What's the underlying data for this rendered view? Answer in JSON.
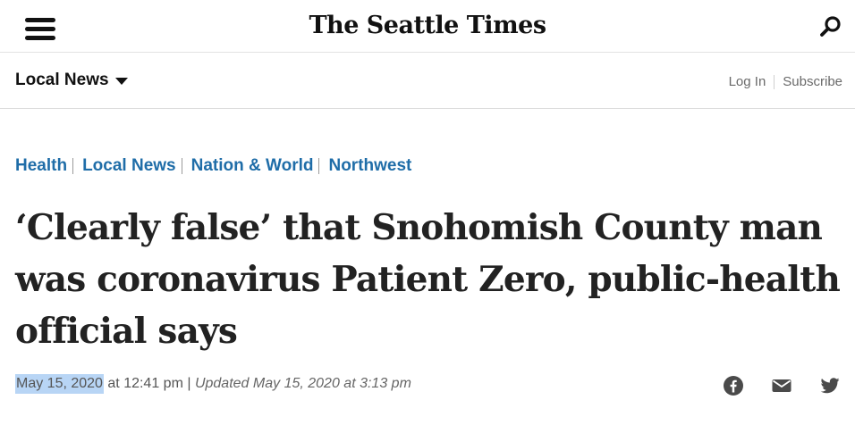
{
  "header": {
    "logo_text": "The Seattle Times",
    "menu_icon": "hamburger-menu-icon",
    "search_icon": "search-icon"
  },
  "section_bar": {
    "title": "Local News",
    "login_label": "Log In",
    "subscribe_label": "Subscribe"
  },
  "tags": [
    "Health",
    "Local News",
    "Nation & World",
    "Northwest"
  ],
  "article": {
    "headline": "‘Clearly false’ that Snohomish County man was coronavirus Patient Zero, public-health official says",
    "published_date": "May 15, 2020",
    "published_time": " at 12:41 pm",
    "separator": " | ",
    "updated": "Updated May 15, 2020 at 3:13 pm"
  },
  "share": {
    "icons": [
      "facebook-icon",
      "email-icon",
      "twitter-icon"
    ]
  },
  "colors": {
    "link_blue": "#1f6da8",
    "headline_text": "#222222",
    "selection_highlight": "#b8d5f5"
  }
}
